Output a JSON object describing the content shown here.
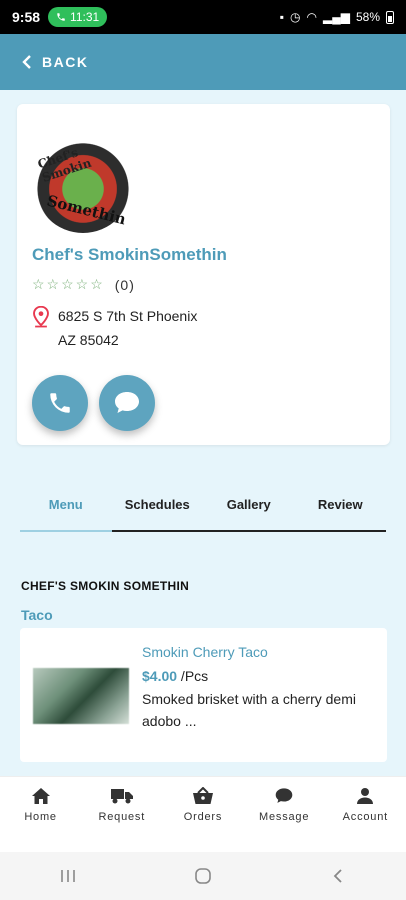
{
  "status_bar": {
    "time": "9:58",
    "call_time": "11:31",
    "battery": "58%"
  },
  "app_bar": {
    "back_label": "BACK"
  },
  "profile": {
    "logo_text_top": "Chef's Smokin",
    "logo_text_bottom": "Somethin",
    "name": "Chef's SmokinSomethin",
    "stars": "☆☆☆☆☆",
    "rating_count": "(0)",
    "address_line1": "6825 S 7th St Phoenix",
    "address_line2": "AZ 85042"
  },
  "tabs": [
    {
      "label": "Menu",
      "active": true
    },
    {
      "label": "Schedules",
      "active": false
    },
    {
      "label": "Gallery",
      "active": false
    },
    {
      "label": "Review",
      "active": false
    }
  ],
  "menu": {
    "section_title": "CHEF'S SMOKIN SOMETHIN",
    "category": "Taco",
    "items": [
      {
        "name": "Smokin Cherry Taco",
        "price": "$4.00",
        "unit": " /Pcs",
        "description": "Smoked brisket with a cherry demi adobo ..."
      }
    ]
  },
  "bottom_nav": [
    {
      "label": "Home",
      "icon": "home-icon"
    },
    {
      "label": "Request",
      "icon": "truck-icon"
    },
    {
      "label": "Orders",
      "icon": "basket-icon"
    },
    {
      "label": "Message",
      "icon": "chat-icon"
    },
    {
      "label": "Account",
      "icon": "person-icon"
    }
  ],
  "colors": {
    "primary": "#4e9bb8",
    "background": "#e6f5fb",
    "star": "#7cb07a",
    "pin": "#e8384f"
  }
}
